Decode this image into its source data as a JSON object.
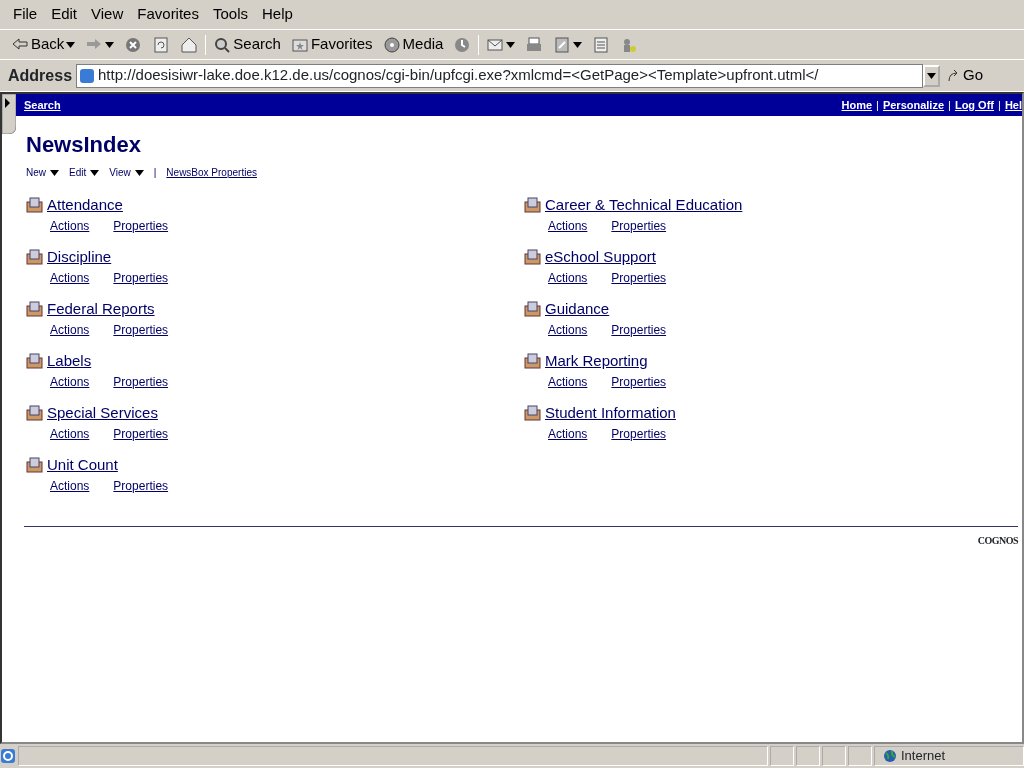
{
  "menu_bar": [
    "File",
    "Edit",
    "View",
    "Favorites",
    "Tools",
    "Help"
  ],
  "toolbar": [
    {
      "kind": "back",
      "label": "Back"
    },
    {
      "kind": "forward"
    },
    {
      "kind": "stop"
    },
    {
      "kind": "refresh"
    },
    {
      "kind": "home"
    },
    {
      "kind": "sep"
    },
    {
      "kind": "search",
      "label": "Search"
    },
    {
      "kind": "favorites",
      "label": "Favorites"
    },
    {
      "kind": "media",
      "label": "Media"
    },
    {
      "kind": "history"
    },
    {
      "kind": "sep"
    },
    {
      "kind": "mail"
    },
    {
      "kind": "print"
    },
    {
      "kind": "edit"
    },
    {
      "kind": "discuss"
    },
    {
      "kind": "messenger"
    }
  ],
  "address_bar": {
    "label": "Address",
    "url": "http://doesisiwr-lake.doe.k12.de.us/cognos/cgi-bin/upfcgi.exe?xmlcmd=<GetPage><Template>upfront.utml</",
    "go": "Go"
  },
  "header_bar": {
    "left_link": "Search",
    "right_links": [
      "Home",
      "Personalize",
      "Log Off",
      "Hel"
    ],
    "separators": [
      "|",
      "|",
      "|"
    ]
  },
  "page_title": "NewsIndex",
  "page_menu": [
    "New",
    "Edit",
    "View"
  ],
  "page_menu_separator": "|",
  "page_link": "NewsBox Properties",
  "columns": [
    [
      {
        "title": "Attendance",
        "actions": "Actions",
        "properties": "Properties"
      },
      {
        "title": "Discipline",
        "actions": "Actions",
        "properties": "Properties"
      },
      {
        "title": "Federal Reports",
        "actions": "Actions",
        "properties": "Properties"
      },
      {
        "title": "Labels",
        "actions": "Actions",
        "properties": "Properties"
      },
      {
        "title": "Special Services",
        "actions": "Actions",
        "properties": "Properties"
      },
      {
        "title": "Unit Count",
        "actions": "Actions",
        "properties": "Properties"
      }
    ],
    [
      {
        "title": "Career & Technical Education",
        "actions": "Actions",
        "properties": "Properties"
      },
      {
        "title": "eSchool Support",
        "actions": "Actions",
        "properties": "Properties"
      },
      {
        "title": "Guidance",
        "actions": "Actions",
        "properties": "Properties"
      },
      {
        "title": "Mark Reporting",
        "actions": "Actions",
        "properties": "Properties"
      },
      {
        "title": "Student Information",
        "actions": "Actions",
        "properties": "Properties"
      }
    ]
  ],
  "footer_logo": "COGNOS",
  "status_bar": {
    "zone": "Internet"
  }
}
